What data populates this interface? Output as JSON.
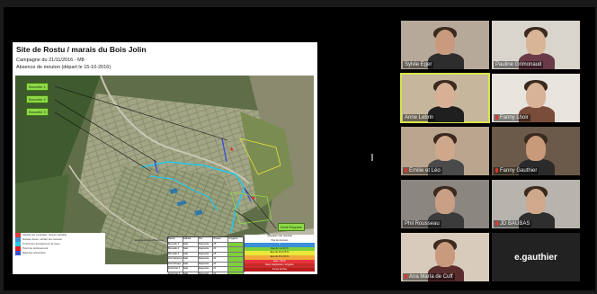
{
  "slide": {
    "title": "Site de Rostu / marais du Bois Jolin",
    "subtitle_line1": "Campagne du 21/11/2016 - M8",
    "subtitle_line2": "Absence de mouton (départ le 15-10-2016)",
    "map_tags_left": [
      "Bouvelle 1",
      "Bouvelle 2",
      "Bouvelle 3"
    ],
    "map_tags_right": [
      "Droit Esquive",
      "Droit Risque",
      "Extrémité 2"
    ],
    "side_note": "écologique et effluences",
    "legend_left": [
      "Vérifier les contrôles: niveau variable",
      "Niveau d'eau: vérifier les niveaux",
      "Circuit de l'écoulement de l'eau",
      "Point de prélèvement",
      "Espèces associées"
    ],
    "table_rows": [
      [
        "Bassin",
        "Salinité",
        "Pbs",
        "Niveau",
        "Oxygène"
      ],
      [
        "Bouvelle 1",
        "Salé",
        "Stagnante",
        "25",
        ""
      ],
      [
        "Bouvelle 2",
        "Salé",
        "Stagnante",
        "23",
        ""
      ],
      [
        "Bouvelle 3",
        "Salé",
        "Stagnante",
        "25",
        ""
      ],
      [
        "Droit Esquive",
        "Salé",
        "Stagnante",
        "22",
        ""
      ],
      [
        "Droit Risque",
        "Salé",
        "Stagnante",
        "23",
        ""
      ],
      [
        "Extrémité 2",
        "Salé",
        "Stagnante",
        "21",
        ""
      ],
      [
        "Extrémité 3",
        "Salé",
        "Stagnante",
        "22",
        ""
      ]
    ],
    "legend_right": [
      {
        "text": "Intégration des résultats",
        "color": "#ffffff"
      },
      {
        "text": "Pas de données",
        "color": "#ffffff"
      },
      {
        "text": "1",
        "color": "#3a8fd8"
      },
      {
        "text": "Eau de 1 à 10 %",
        "color": "#7fcf3a"
      },
      {
        "text": "Eau de 10 à 25 %",
        "color": "#e8e83a"
      },
      {
        "text": "Eau de 25 à 50 %",
        "color": "#f0a93a"
      },
      {
        "text": "Eau > 50 %",
        "color": "#e8333a"
      },
      {
        "text": "Eaux stagnantes / oxygène",
        "color": "#c92a2a"
      },
      {
        "text": "Zones sèches",
        "color": "#b71c1c"
      }
    ]
  },
  "participants": [
    {
      "name": "Sylvie Eger",
      "muted": false,
      "bg": "#b7a99a",
      "skin": "#c99a7e",
      "shirt": "#2d2d2d",
      "active": false
    },
    {
      "name": "Pauline Grimonaud",
      "muted": false,
      "bg": "#d9d4cc",
      "skin": "#d8b596",
      "shirt": "#6b3a48",
      "active": false
    },
    {
      "name": "Anne Lebrin",
      "muted": false,
      "bg": "#c6b69c",
      "skin": "#d7b095",
      "shirt": "#1f1f1f",
      "active": true
    },
    {
      "name": "Fanny Lhoir",
      "muted": true,
      "bg": "#e8e4de",
      "skin": "#d9b398",
      "shirt": "#7a4c3a",
      "active": false
    },
    {
      "name": "Emilie et Léo",
      "muted": true,
      "bg": "#b9a58e",
      "skin": "#cfa78a",
      "shirt": "#4a4a4a",
      "active": false
    },
    {
      "name": "Fanny Gauthier",
      "muted": true,
      "bg": "#6b5a4a",
      "skin": "#c89a7a",
      "shirt": "#2b2b2b",
      "active": false
    },
    {
      "name": "Phil Rousseau",
      "muted": false,
      "bg": "#8c8680",
      "skin": "#c99f86",
      "shirt": "#3b3b3b",
      "active": false
    },
    {
      "name": "JD BAUBAS",
      "muted": true,
      "bg": "#b7b3ad",
      "skin": "#d0a88b",
      "shirt": "#2e2e2e",
      "active": false
    },
    {
      "name": "Ana María de Cuff",
      "muted": true,
      "bg": "#d8cbbb",
      "skin": "#c99a7e",
      "shirt": "#5a2d2d",
      "active": false
    }
  ],
  "name_only_tile": "e.gauthier"
}
